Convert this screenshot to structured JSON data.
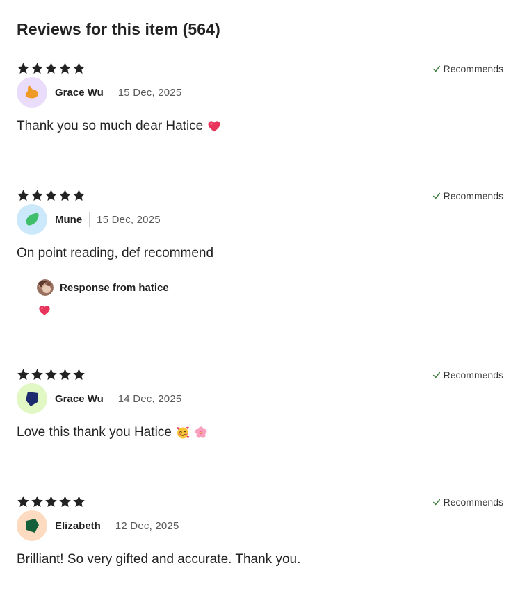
{
  "page": {
    "title": "Reviews for this item (564)"
  },
  "reviews": [
    {
      "rating": 5,
      "recommends_label": "Recommends",
      "author": "Grace Wu",
      "date": "15 Dec, 2025",
      "text": "Thank you so much dear Hatice",
      "text_emojis": [
        "heart-emoji"
      ],
      "avatar": {
        "bg": "#eadcfb",
        "shape": "blob",
        "color": "#f09a26"
      }
    },
    {
      "rating": 5,
      "recommends_label": "Recommends",
      "author": "Mune",
      "date": "15 Dec, 2025",
      "text": "On point reading, def recommend",
      "text_emojis": [],
      "avatar": {
        "bg": "#cce8fb",
        "shape": "leaf",
        "color": "#3fbf6a"
      },
      "response": {
        "label": "Response from hatice",
        "body_emojis": [
          "heart-emoji"
        ]
      }
    },
    {
      "rating": 5,
      "recommends_label": "Recommends",
      "author": "Grace Wu",
      "date": "14 Dec, 2025",
      "text": "Love this thank you Hatice",
      "text_emojis": [
        "smiling-face-with-hearts-emoji",
        "cherry-blossom-emoji"
      ],
      "avatar": {
        "bg": "#e1f7c4",
        "shape": "pentagon",
        "color": "#1e2a6e"
      }
    },
    {
      "rating": 5,
      "recommends_label": "Recommends",
      "author": "Elizabeth",
      "date": "12 Dec, 2025",
      "text": "Brilliant! So very gifted and accurate. Thank you.",
      "text_emojis": [],
      "avatar": {
        "bg": "#fddbc0",
        "shape": "pentagon",
        "color": "#15603a"
      }
    }
  ]
}
